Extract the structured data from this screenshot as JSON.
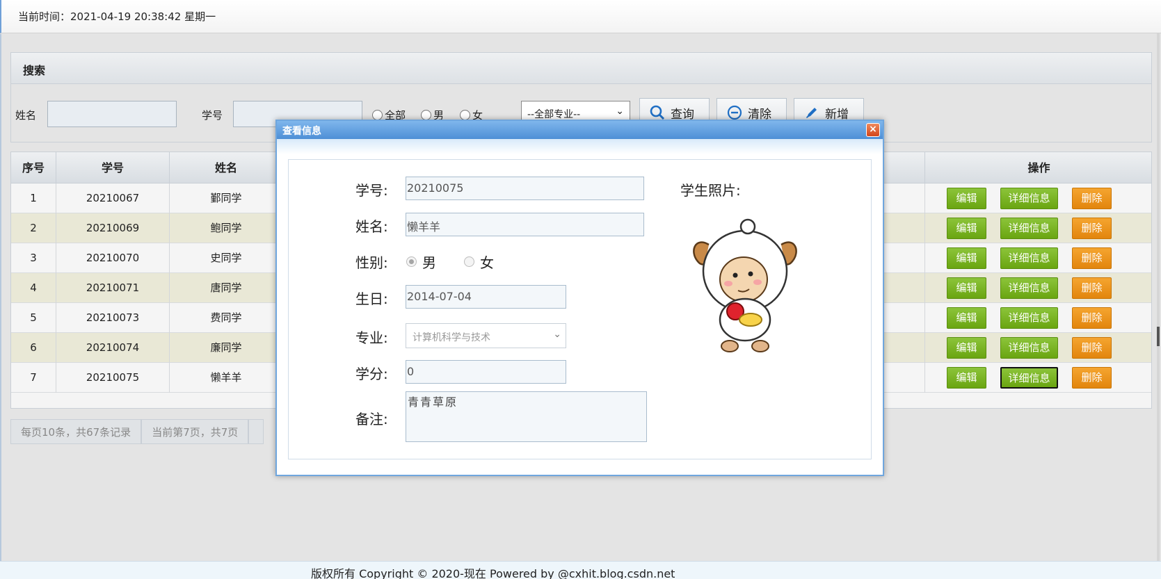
{
  "topbar": {
    "time_text": "当前时间：2021-04-19 20:38:42 星期一"
  },
  "search": {
    "title": "搜索",
    "name_label": "姓名",
    "id_label": "学号",
    "radio_all": "全部",
    "radio_male": "男",
    "radio_female": "女",
    "major_select": "--全部专业--",
    "query_label": "查询",
    "clear_label": "清除",
    "add_label": "新增"
  },
  "table": {
    "headers": {
      "index": "序号",
      "student_id": "学号",
      "name": "姓名",
      "ops": "操作"
    },
    "action_labels": {
      "edit": "编辑",
      "detail": "详细信息",
      "delete": "删除"
    },
    "rows": [
      {
        "index": "1",
        "student_id": "20210067",
        "name": "鄞同学"
      },
      {
        "index": "2",
        "student_id": "20210069",
        "name": "鲍同学"
      },
      {
        "index": "3",
        "student_id": "20210070",
        "name": "史同学"
      },
      {
        "index": "4",
        "student_id": "20210071",
        "name": "唐同学"
      },
      {
        "index": "5",
        "student_id": "20210073",
        "name": "费同学"
      },
      {
        "index": "6",
        "student_id": "20210074",
        "name": "廉同学"
      },
      {
        "index": "7",
        "student_id": "20210075",
        "name": "懒羊羊"
      }
    ]
  },
  "pager": {
    "per_page": "每页10条，共67条记录",
    "current": "当前第7页，共7页"
  },
  "dialog": {
    "title": "查看信息",
    "close": "×",
    "id_label": "学号:",
    "id_value": "20210075",
    "name_label": "姓名:",
    "name_value": "懒羊羊",
    "gender_label": "性别:",
    "gender_male": "男",
    "gender_female": "女",
    "birthday_label": "生日:",
    "birthday_value": "2014-07-04",
    "major_label": "专业:",
    "major_value": "计算机科学与技术",
    "credit_label": "学分:",
    "credit_value": "0",
    "remark_label": "备注:",
    "remark_value": "青青草原",
    "photo_label": "学生照片:"
  },
  "footer": {
    "text": "版权所有 Copyright © 2020-现在 Powered by @cxhit.blog.csdn.net"
  }
}
